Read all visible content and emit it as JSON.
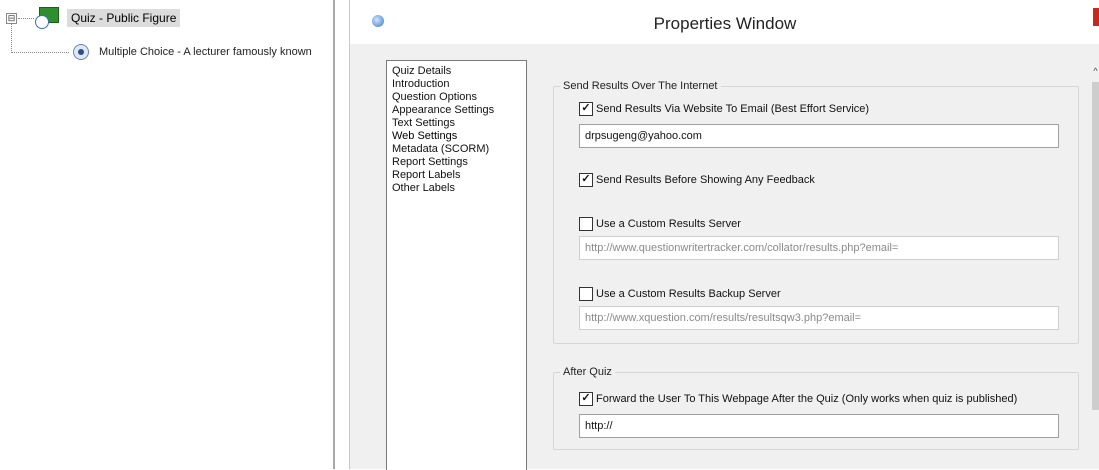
{
  "tree": {
    "expander": "⊟",
    "root_label": "Quiz - Public Figure",
    "child_label": "Multiple Choice - A lecturer famously known"
  },
  "window": {
    "title": "Properties Window"
  },
  "sidebar": {
    "items": [
      {
        "label": "Quiz Details"
      },
      {
        "label": "Introduction"
      },
      {
        "label": "Question Options"
      },
      {
        "label": "Appearance Settings"
      },
      {
        "label": "Text Settings"
      },
      {
        "label": "Web Settings"
      },
      {
        "label": "Metadata (SCORM)"
      },
      {
        "label": "Report Settings"
      },
      {
        "label": "Report Labels"
      },
      {
        "label": "Other Labels"
      }
    ],
    "selected": "Web Settings"
  },
  "send_results": {
    "legend": "Send Results Over The Internet",
    "send_via_website": {
      "checked": true,
      "mark": "✓",
      "label": "Send Results Via Website To Email (Best Effort Service)"
    },
    "email_value": "drpsugeng@yahoo.com",
    "before_feedback": {
      "checked": true,
      "mark": "✓",
      "label": "Send Results Before Showing Any Feedback"
    },
    "custom_server": {
      "checked": false,
      "mark": "",
      "label": "Use a Custom Results Server"
    },
    "custom_server_url": "http://www.questionwritertracker.com/collator/results.php?email=",
    "custom_backup": {
      "checked": false,
      "mark": "",
      "label": "Use a Custom Results Backup Server"
    },
    "custom_backup_url": "http://www.xquestion.com/results/resultsqw3.php?email="
  },
  "after_quiz": {
    "legend": "After Quiz",
    "forward": {
      "checked": true,
      "mark": "✓",
      "label": "Forward the User To This Webpage After the Quiz (Only works when quiz is published)"
    },
    "url_value": "http://"
  },
  "colors": {
    "close_button": "#c42b1c",
    "quiz_icon_green": "#2f8f2f",
    "window_bg": "#f0f0f0"
  }
}
